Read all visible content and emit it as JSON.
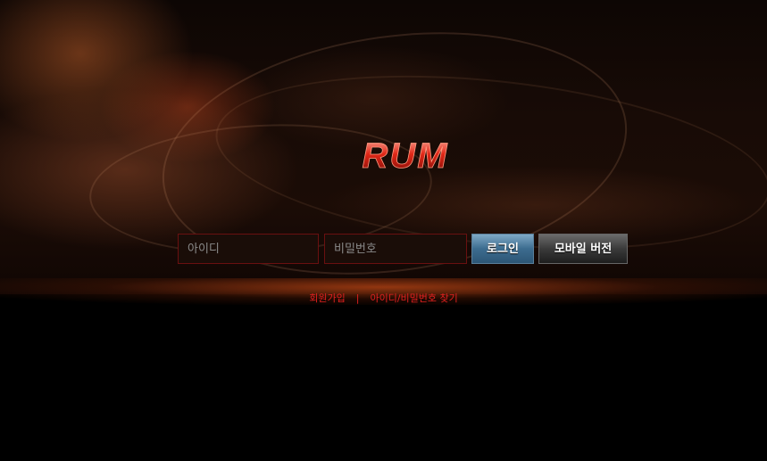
{
  "brand": {
    "logo_text": "RUM"
  },
  "login_form": {
    "id_placeholder": "아이디",
    "password_placeholder": "비밀번호",
    "login_label": "로그인",
    "mobile_label": "모바일 버전"
  },
  "links": {
    "signup": "회원가입",
    "separator": "|",
    "find_account": "아이디/비밀번호 찾기"
  },
  "colors": {
    "accent_red": "#e02020",
    "login_blue": "#3c6c8f"
  }
}
